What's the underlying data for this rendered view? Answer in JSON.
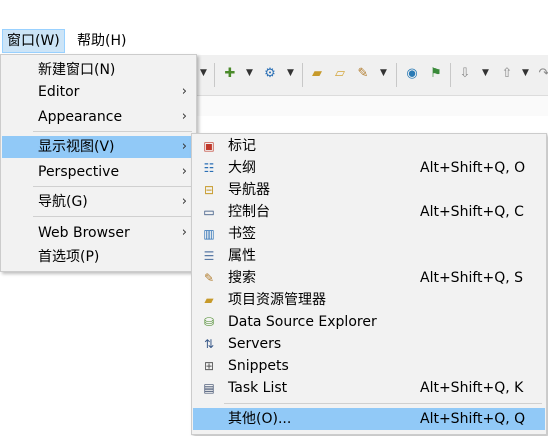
{
  "menubar": {
    "window": "窗口(W)",
    "help": "帮助(H)"
  },
  "toolbar": {
    "icons": [
      "new-wizard-icon",
      "run-icon",
      "open-folder-icon",
      "open-file-icon",
      "marker-icon",
      "globe-icon",
      "external-tool-icon",
      "next-annotation-icon",
      "prev-annotation-icon",
      "forward-icon"
    ]
  },
  "window_menu": {
    "items": [
      {
        "label": "新建窗口(N)"
      },
      {
        "label": "Editor"
      },
      {
        "label": "Appearance"
      },
      {
        "label": "显示视图(V)"
      },
      {
        "label": "Perspective"
      },
      {
        "label": "导航(G)"
      },
      {
        "label": "Web Browser"
      },
      {
        "label": "首选项(P)"
      }
    ]
  },
  "show_view_menu": {
    "items": [
      {
        "label": "标记",
        "accel": "",
        "icon": "markers-icon"
      },
      {
        "label": "大纲",
        "accel": "Alt+Shift+Q, O",
        "icon": "outline-icon"
      },
      {
        "label": "导航器",
        "accel": "",
        "icon": "navigator-icon"
      },
      {
        "label": "控制台",
        "accel": "Alt+Shift+Q, C",
        "icon": "console-icon"
      },
      {
        "label": "书签",
        "accel": "",
        "icon": "bookmarks-icon"
      },
      {
        "label": "属性",
        "accel": "",
        "icon": "properties-icon"
      },
      {
        "label": "搜索",
        "accel": "Alt+Shift+Q, S",
        "icon": "search-icon"
      },
      {
        "label": "项目资源管理器",
        "accel": "",
        "icon": "project-explorer-icon"
      },
      {
        "label": "Data Source Explorer",
        "accel": "",
        "icon": "data-source-icon"
      },
      {
        "label": "Servers",
        "accel": "",
        "icon": "servers-icon"
      },
      {
        "label": "Snippets",
        "accel": "",
        "icon": "snippets-icon"
      },
      {
        "label": "Task List",
        "accel": "Alt+Shift+Q, K",
        "icon": "task-list-icon"
      },
      {
        "label": "其他(O)...",
        "accel": "Alt+Shift+Q, Q",
        "icon": ""
      }
    ]
  },
  "colors": {
    "highlight": "#91c9f7",
    "menu_bg": "#f2f2f2"
  }
}
